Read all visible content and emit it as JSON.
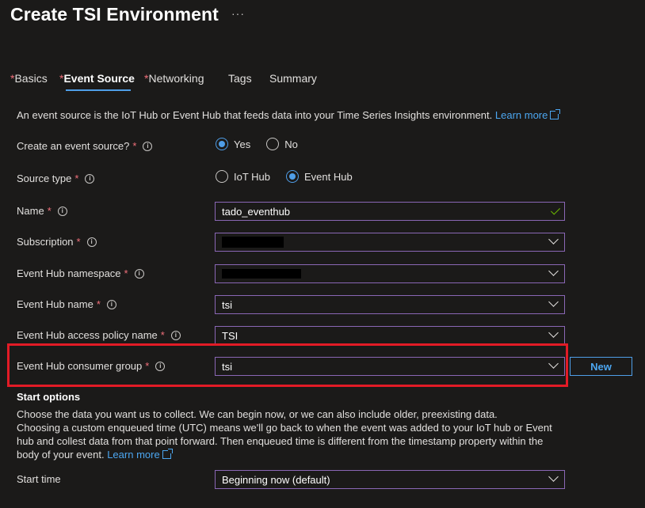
{
  "header": {
    "title": "Create TSI Environment",
    "more": "···"
  },
  "tabs": [
    {
      "label": "Basics",
      "required": true,
      "active": false
    },
    {
      "label": "Event Source",
      "required": true,
      "active": true
    },
    {
      "label": "Networking",
      "required": true,
      "active": false
    },
    {
      "label": "Tags",
      "required": false,
      "active": false
    },
    {
      "label": "Summary",
      "required": false,
      "active": false
    }
  ],
  "intro": {
    "text": "An event source is the IoT Hub or Event Hub that feeds data into your Time Series Insights environment.",
    "link": "Learn more"
  },
  "form": {
    "create_event_source": {
      "label": "Create an event source?",
      "options": [
        "Yes",
        "No"
      ],
      "selected": "Yes"
    },
    "source_type": {
      "label": "Source type",
      "options": [
        "IoT Hub",
        "Event Hub"
      ],
      "selected": "Event Hub"
    },
    "name": {
      "label": "Name",
      "value": "tado_eventhub"
    },
    "subscription": {
      "label": "Subscription",
      "value": ""
    },
    "namespace": {
      "label": "Event Hub namespace",
      "value": ""
    },
    "hub_name": {
      "label": "Event Hub name",
      "value": "tsi"
    },
    "access_policy": {
      "label": "Event Hub access policy name",
      "value": "TSI"
    },
    "consumer_group": {
      "label": "Event Hub consumer group",
      "value": "tsi",
      "new_label": "New"
    }
  },
  "start_options": {
    "title": "Start options",
    "line1": "Choose the data you want us to collect. We can begin now, or we can also include older, preexisting data.",
    "line2": "Choosing a custom enqueued time (UTC) means we'll go back to when the event was added to your IoT hub or Event",
    "line3": "hub and collest data from that point forward. Then enqueued time is different from the timestamp property within the",
    "line4": "body of your event.",
    "link": "Learn more",
    "start_time_label": "Start time",
    "start_time_value": "Beginning now (default)"
  },
  "colors": {
    "accent": "#4f9ee8",
    "required": "#f1707b",
    "highlight": "#e21b26",
    "field_border": "#8a67b5"
  }
}
